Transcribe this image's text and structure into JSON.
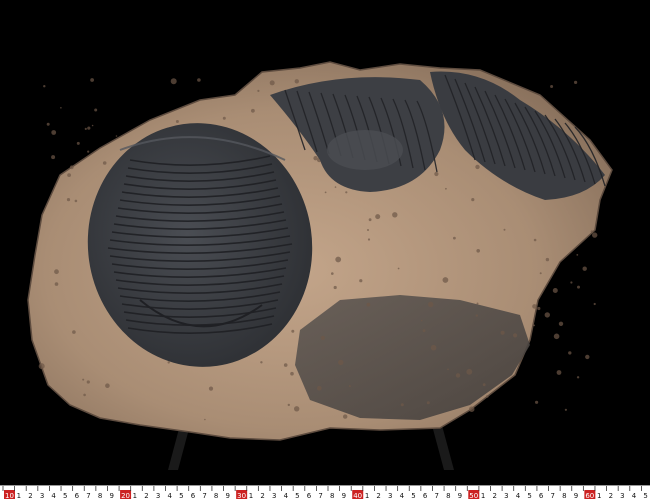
{
  "image": {
    "subject": "fossil trilobite slab",
    "background_color": "#000000",
    "rock_colors": [
      "#b89a80",
      "#a58a72",
      "#8f7662"
    ],
    "fossil_color": "#3b3d42",
    "ridge_color": "#25272b"
  },
  "ruler": {
    "major_labels": [
      "10",
      "1",
      "2",
      "3",
      "4",
      "5",
      "6",
      "7",
      "8",
      "9",
      "20",
      "1",
      "2",
      "3",
      "4",
      "5",
      "6",
      "7",
      "8",
      "9",
      "30",
      "1",
      "2",
      "3",
      "4",
      "5",
      "6",
      "7",
      "8",
      "9",
      "40",
      "1",
      "2",
      "3",
      "4",
      "5",
      "6",
      "7",
      "8",
      "9",
      "50",
      "1",
      "2",
      "3",
      "4",
      "5",
      "6",
      "7",
      "8",
      "9",
      "60",
      "1",
      "2",
      "3",
      "4",
      "5"
    ],
    "highlighted_labels": [
      "10",
      "20",
      "30",
      "40",
      "50",
      "60"
    ],
    "highlight_color": "#cc2222"
  }
}
